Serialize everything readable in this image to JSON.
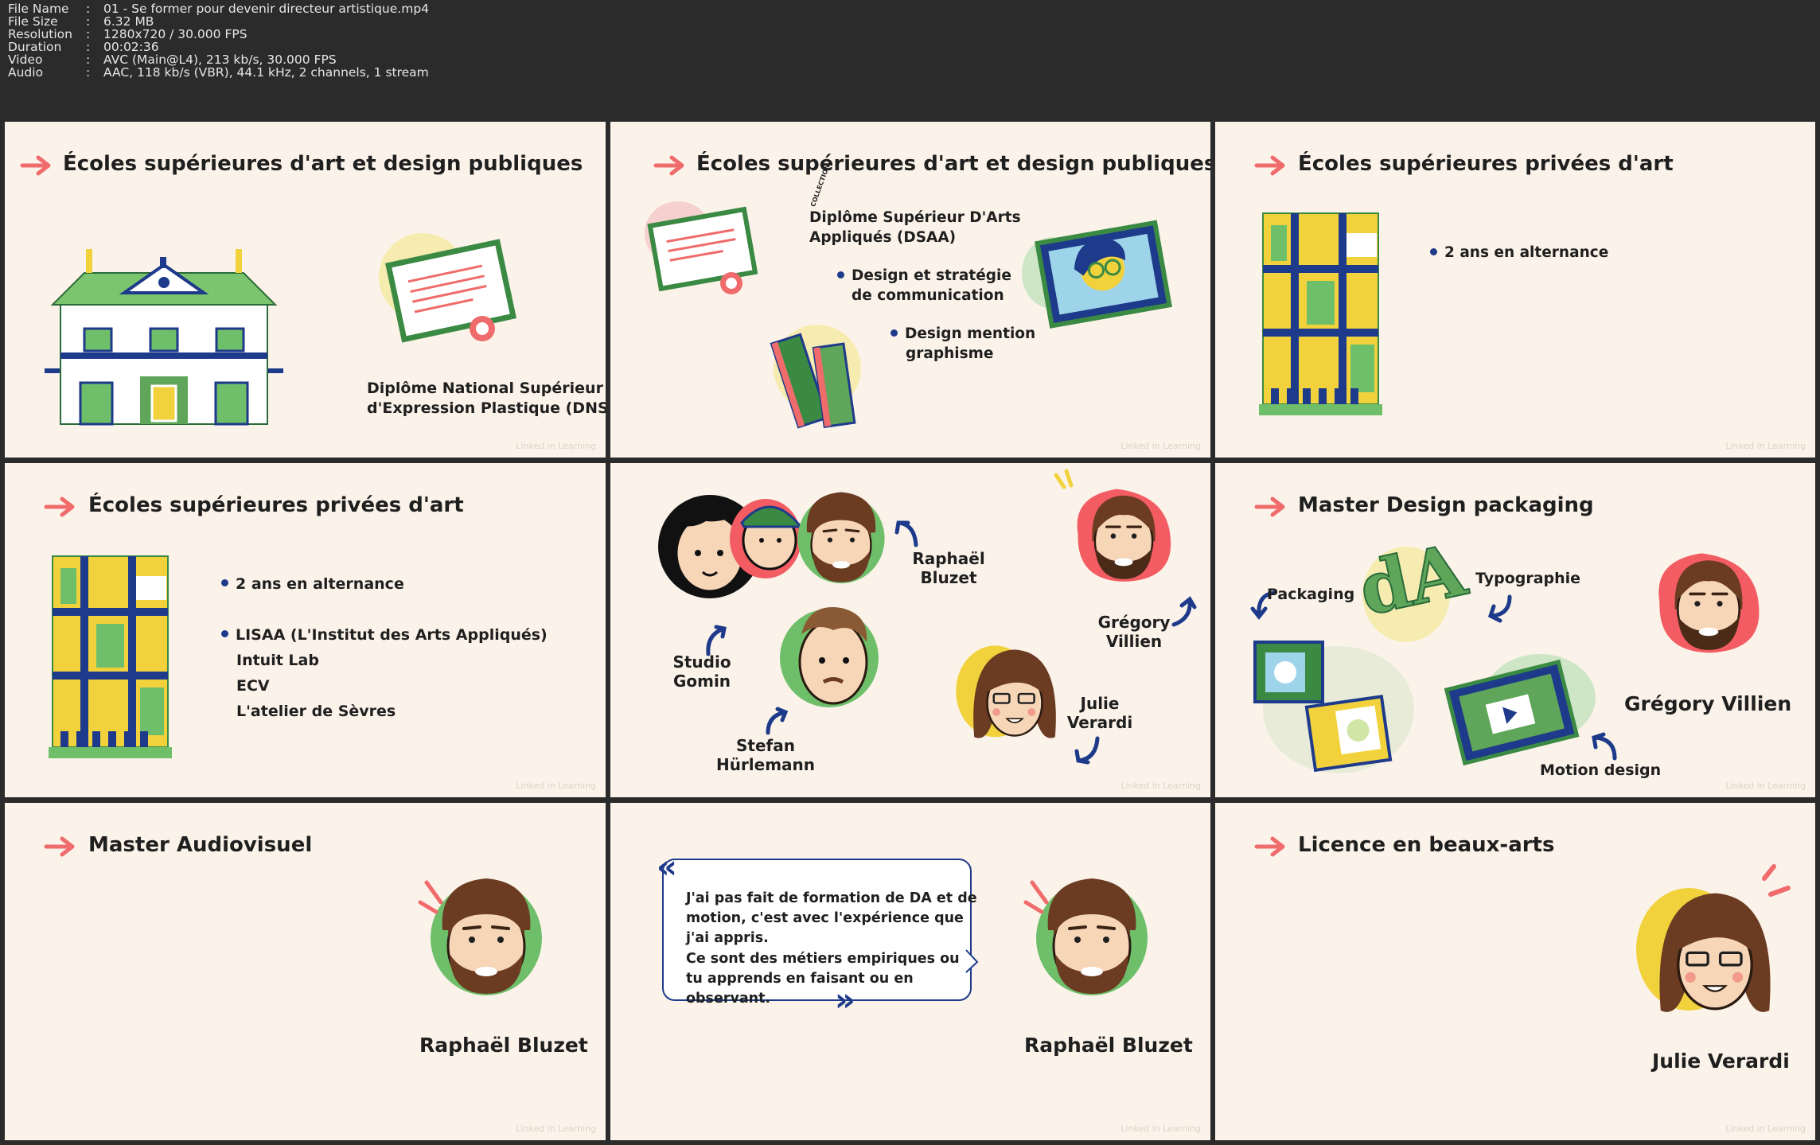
{
  "meta": {
    "rows": [
      {
        "key": "File Name",
        "value": "01 - Se former pour devenir directeur artistique.mp4"
      },
      {
        "key": "File Size",
        "value": "6.32 MB"
      },
      {
        "key": "Resolution",
        "value": "1280x720 / 30.000 FPS"
      },
      {
        "key": "Duration",
        "value": "00:02:36"
      },
      {
        "key": "Video",
        "value": "AVC (Main@L4), 213 kb/s, 30.000 FPS"
      },
      {
        "key": "Audio",
        "value": "AAC, 118 kb/s (VBR), 44.1 kHz, 2 channels, 1 stream"
      }
    ]
  },
  "watermark": "Linked in Learning",
  "panels": {
    "p1": {
      "title": "Écoles supérieures d'art et design publiques",
      "line1": "Diplôme National Supérieur",
      "line2": "d'Expression Plastique (DNSEP)"
    },
    "p2": {
      "title": "Écoles supérieures d'art et design publiques",
      "diploma1": "Diplôme Supérieur D'Arts",
      "diploma2": "Appliqués (DSAA)",
      "b1a": "Design et stratégie",
      "b1b": "de communication",
      "b2a": "Design mention",
      "b2b": "graphisme",
      "book_label": "COLLECTION"
    },
    "p3": {
      "title": "Écoles supérieures privées d'art",
      "bullet": "2 ans en alternance"
    },
    "p4": {
      "title": "Écoles supérieures privées d'art",
      "bullet1": "2 ans en alternance",
      "bullet2": "LISAA (L'Institut des Arts Appliqués)",
      "item2": "Intuit Lab",
      "item3": "ECV",
      "item4": "L'atelier de Sèvres"
    },
    "p5": {
      "n1a": "Raphaël",
      "n1b": "Bluzet",
      "n2a": "Grégory",
      "n2b": "Villien",
      "n3a": "Studio",
      "n3b": "Gomin",
      "n4a": "Stefan",
      "n4b": "Hürlemann",
      "n5a": "Julie",
      "n5b": "Verardi"
    },
    "p6": {
      "title": "Master Design packaging",
      "packaging": "Packaging",
      "typographie": "Typographie",
      "name": "Grégory Villien",
      "motion": "Motion design"
    },
    "p7": {
      "title": "Master Audiovisuel",
      "name": "Raphaël Bluzet"
    },
    "p8": {
      "q1": "J'ai pas fait de formation de DA et de",
      "q2": "motion, c'est avec l'expérience que",
      "q3": "j'ai appris.",
      "q4": "Ce sont des métiers empiriques ou",
      "q5": "tu apprends en faisant ou en",
      "q6": "observant.",
      "name": "Raphaël Bluzet"
    },
    "p9": {
      "title": "Licence en beaux-arts",
      "name": "Julie Verardi"
    }
  },
  "colors": {
    "panel_bg": "#fbf3ea",
    "arrow": "#f06b6b",
    "navy": "#1e3a8a",
    "green": "#5fa55a",
    "yellow": "#f2d23c",
    "skin": "#f7d6b8",
    "beard": "#6b3b22"
  }
}
